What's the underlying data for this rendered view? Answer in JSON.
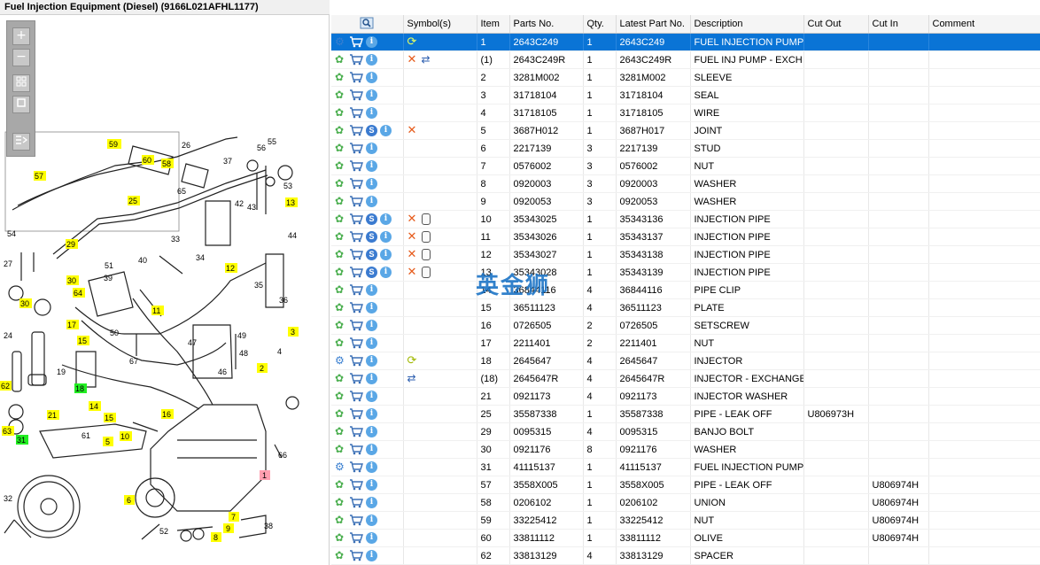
{
  "window": {
    "title": "Fuel Injection Equipment (Diesel) (9166L021AFHL1177)"
  },
  "watermark": "英金狮",
  "zoom_toolbar": {
    "zoom_in": "+",
    "zoom_out": "−"
  },
  "diagram": {
    "callouts": [
      {
        "n": "59",
        "hl": "yellow"
      },
      {
        "n": "60",
        "hl": "yellow"
      },
      {
        "n": "58",
        "hl": "yellow"
      },
      {
        "n": "26",
        "hl": "none"
      },
      {
        "n": "56",
        "hl": "none"
      },
      {
        "n": "55",
        "hl": "none"
      },
      {
        "n": "37",
        "hl": "none"
      },
      {
        "n": "57",
        "hl": "yellow"
      },
      {
        "n": "65",
        "hl": "none"
      },
      {
        "n": "53",
        "hl": "none"
      },
      {
        "n": "25",
        "hl": "yellow"
      },
      {
        "n": "42",
        "hl": "none"
      },
      {
        "n": "43",
        "hl": "none"
      },
      {
        "n": "13",
        "hl": "yellow"
      },
      {
        "n": "54",
        "hl": "none"
      },
      {
        "n": "29",
        "hl": "yellow"
      },
      {
        "n": "33",
        "hl": "none"
      },
      {
        "n": "44",
        "hl": "none"
      },
      {
        "n": "27",
        "hl": "none"
      },
      {
        "n": "51",
        "hl": "none"
      },
      {
        "n": "40",
        "hl": "none"
      },
      {
        "n": "34",
        "hl": "none"
      },
      {
        "n": "12",
        "hl": "yellow"
      },
      {
        "n": "30",
        "hl": "yellow"
      },
      {
        "n": "39",
        "hl": "none"
      },
      {
        "n": "64",
        "hl": "yellow"
      },
      {
        "n": "30",
        "hl": "yellow"
      },
      {
        "n": "11",
        "hl": "yellow"
      },
      {
        "n": "35",
        "hl": "none"
      },
      {
        "n": "36",
        "hl": "none"
      },
      {
        "n": "24",
        "hl": "none"
      },
      {
        "n": "17",
        "hl": "yellow"
      },
      {
        "n": "15",
        "hl": "yellow"
      },
      {
        "n": "50",
        "hl": "none"
      },
      {
        "n": "47",
        "hl": "none"
      },
      {
        "n": "49",
        "hl": "none"
      },
      {
        "n": "48",
        "hl": "none"
      },
      {
        "n": "3",
        "hl": "yellow"
      },
      {
        "n": "67",
        "hl": "none"
      },
      {
        "n": "46",
        "hl": "none"
      },
      {
        "n": "4",
        "hl": "none"
      },
      {
        "n": "62",
        "hl": "yellow"
      },
      {
        "n": "19",
        "hl": "none"
      },
      {
        "n": "18",
        "hl": "green"
      },
      {
        "n": "2",
        "hl": "yellow"
      },
      {
        "n": "14",
        "hl": "yellow"
      },
      {
        "n": "21",
        "hl": "yellow"
      },
      {
        "n": "15",
        "hl": "yellow"
      },
      {
        "n": "16",
        "hl": "yellow"
      },
      {
        "n": "63",
        "hl": "yellow"
      },
      {
        "n": "61",
        "hl": "none"
      },
      {
        "n": "10",
        "hl": "yellow"
      },
      {
        "n": "31",
        "hl": "green"
      },
      {
        "n": "5",
        "hl": "yellow"
      },
      {
        "n": "66",
        "hl": "none"
      },
      {
        "n": "1",
        "hl": "pink"
      },
      {
        "n": "6",
        "hl": "yellow"
      },
      {
        "n": "32",
        "hl": "none"
      },
      {
        "n": "52",
        "hl": "none"
      },
      {
        "n": "7",
        "hl": "yellow"
      },
      {
        "n": "9",
        "hl": "yellow"
      },
      {
        "n": "8",
        "hl": "yellow"
      },
      {
        "n": "38",
        "hl": "none"
      }
    ]
  },
  "grid": {
    "headers": {
      "icons": "",
      "symbols": "Symbol(s)",
      "item": "Item",
      "parts_no": "Parts No.",
      "qty": "Qty.",
      "latest": "Latest Part No.",
      "description": "Description",
      "cut_out": "Cut Out",
      "cut_in": "Cut In",
      "comment": "Comment"
    },
    "rows": [
      {
        "item": "1",
        "part": "2643C249",
        "qty": "1",
        "latest": "2643C249",
        "desc": "FUEL INJECTION PUMP",
        "cut_out": "",
        "cut_in": "",
        "comment": "",
        "s": false,
        "syms": [
          "recycle"
        ],
        "gear": "multi",
        "selected": true
      },
      {
        "item": "(1)",
        "part": "2643C249R",
        "qty": "1",
        "latest": "2643C249R",
        "desc": "FUEL INJ PUMP - EXCH",
        "cut_out": "",
        "cut_in": "",
        "comment": "",
        "s": false,
        "syms": [
          "x",
          "exchange"
        ],
        "gear": "single",
        "selected": false
      },
      {
        "item": "2",
        "part": "3281M002",
        "qty": "1",
        "latest": "3281M002",
        "desc": "SLEEVE",
        "cut_out": "",
        "cut_in": "",
        "comment": "",
        "s": false,
        "syms": [],
        "gear": "single",
        "selected": false
      },
      {
        "item": "3",
        "part": "31718104",
        "qty": "1",
        "latest": "31718104",
        "desc": "SEAL",
        "cut_out": "",
        "cut_in": "",
        "comment": "",
        "s": false,
        "syms": [],
        "gear": "single",
        "selected": false
      },
      {
        "item": "4",
        "part": "31718105",
        "qty": "1",
        "latest": "31718105",
        "desc": "WIRE",
        "cut_out": "",
        "cut_in": "",
        "comment": "",
        "s": false,
        "syms": [],
        "gear": "single",
        "selected": false
      },
      {
        "item": "5",
        "part": "3687H012",
        "qty": "1",
        "latest": "3687H017",
        "desc": "JOINT",
        "cut_out": "",
        "cut_in": "",
        "comment": "",
        "s": true,
        "syms": [
          "x"
        ],
        "gear": "single",
        "selected": false
      },
      {
        "item": "6",
        "part": "2217139",
        "qty": "3",
        "latest": "2217139",
        "desc": "STUD",
        "cut_out": "",
        "cut_in": "",
        "comment": "",
        "s": false,
        "syms": [],
        "gear": "single",
        "selected": false
      },
      {
        "item": "7",
        "part": "0576002",
        "qty": "3",
        "latest": "0576002",
        "desc": "NUT",
        "cut_out": "",
        "cut_in": "",
        "comment": "",
        "s": false,
        "syms": [],
        "gear": "single",
        "selected": false
      },
      {
        "item": "8",
        "part": "0920003",
        "qty": "3",
        "latest": "0920003",
        "desc": "WASHER",
        "cut_out": "",
        "cut_in": "",
        "comment": "",
        "s": false,
        "syms": [],
        "gear": "single",
        "selected": false
      },
      {
        "item": "9",
        "part": "0920053",
        "qty": "3",
        "latest": "0920053",
        "desc": "WASHER",
        "cut_out": "",
        "cut_in": "",
        "comment": "",
        "s": false,
        "syms": [],
        "gear": "single",
        "selected": false
      },
      {
        "item": "10",
        "part": "35343025",
        "qty": "1",
        "latest": "35343136",
        "desc": "INJECTION PIPE",
        "cut_out": "",
        "cut_in": "",
        "comment": "",
        "s": true,
        "syms": [
          "x",
          "can"
        ],
        "gear": "single",
        "selected": false
      },
      {
        "item": "11",
        "part": "35343026",
        "qty": "1",
        "latest": "35343137",
        "desc": "INJECTION PIPE",
        "cut_out": "",
        "cut_in": "",
        "comment": "",
        "s": true,
        "syms": [
          "x",
          "can"
        ],
        "gear": "single",
        "selected": false
      },
      {
        "item": "12",
        "part": "35343027",
        "qty": "1",
        "latest": "35343138",
        "desc": "INJECTION PIPE",
        "cut_out": "",
        "cut_in": "",
        "comment": "",
        "s": true,
        "syms": [
          "x",
          "can"
        ],
        "gear": "single",
        "selected": false
      },
      {
        "item": "13",
        "part": "35343028",
        "qty": "1",
        "latest": "35343139",
        "desc": "INJECTION PIPE",
        "cut_out": "",
        "cut_in": "",
        "comment": "",
        "s": true,
        "syms": [
          "x",
          "can"
        ],
        "gear": "single",
        "selected": false
      },
      {
        "item": "14",
        "part": "36844116",
        "qty": "4",
        "latest": "36844116",
        "desc": "PIPE CLIP",
        "cut_out": "",
        "cut_in": "",
        "comment": "",
        "s": false,
        "syms": [],
        "gear": "single",
        "selected": false
      },
      {
        "item": "15",
        "part": "36511123",
        "qty": "4",
        "latest": "36511123",
        "desc": "PLATE",
        "cut_out": "",
        "cut_in": "",
        "comment": "",
        "s": false,
        "syms": [],
        "gear": "single",
        "selected": false
      },
      {
        "item": "16",
        "part": "0726505",
        "qty": "2",
        "latest": "0726505",
        "desc": "SETSCREW",
        "cut_out": "",
        "cut_in": "",
        "comment": "",
        "s": false,
        "syms": [],
        "gear": "single",
        "selected": false
      },
      {
        "item": "17",
        "part": "2211401",
        "qty": "2",
        "latest": "2211401",
        "desc": "NUT",
        "cut_out": "",
        "cut_in": "",
        "comment": "",
        "s": false,
        "syms": [],
        "gear": "single",
        "selected": false
      },
      {
        "item": "18",
        "part": "2645647",
        "qty": "4",
        "latest": "2645647",
        "desc": "INJECTOR",
        "cut_out": "",
        "cut_in": "",
        "comment": "",
        "s": false,
        "syms": [
          "recycle"
        ],
        "gear": "multi",
        "selected": false
      },
      {
        "item": "(18)",
        "part": "2645647R",
        "qty": "4",
        "latest": "2645647R",
        "desc": "INJECTOR - EXCHANGE",
        "cut_out": "",
        "cut_in": "",
        "comment": "",
        "s": false,
        "syms": [
          "exchange"
        ],
        "gear": "single",
        "selected": false
      },
      {
        "item": "21",
        "part": "0921173",
        "qty": "4",
        "latest": "0921173",
        "desc": "INJECTOR WASHER",
        "cut_out": "",
        "cut_in": "",
        "comment": "",
        "s": false,
        "syms": [],
        "gear": "single",
        "selected": false
      },
      {
        "item": "25",
        "part": "35587338",
        "qty": "1",
        "latest": "35587338",
        "desc": "PIPE - LEAK OFF",
        "cut_out": "U806973H",
        "cut_in": "",
        "comment": "",
        "s": false,
        "syms": [],
        "gear": "single",
        "selected": false
      },
      {
        "item": "29",
        "part": "0095315",
        "qty": "4",
        "latest": "0095315",
        "desc": "BANJO BOLT",
        "cut_out": "",
        "cut_in": "",
        "comment": "",
        "s": false,
        "syms": [],
        "gear": "single",
        "selected": false
      },
      {
        "item": "30",
        "part": "0921176",
        "qty": "8",
        "latest": "0921176",
        "desc": "WASHER",
        "cut_out": "",
        "cut_in": "",
        "comment": "",
        "s": false,
        "syms": [],
        "gear": "single",
        "selected": false
      },
      {
        "item": "31",
        "part": "41115137",
        "qty": "1",
        "latest": "41115137",
        "desc": "FUEL INJECTION PUMP G",
        "cut_out": "",
        "cut_in": "",
        "comment": "",
        "s": false,
        "syms": [],
        "gear": "multi",
        "selected": false
      },
      {
        "item": "57",
        "part": "3558X005",
        "qty": "1",
        "latest": "3558X005",
        "desc": "PIPE - LEAK OFF",
        "cut_out": "",
        "cut_in": "U806974H",
        "comment": "",
        "s": false,
        "syms": [],
        "gear": "single",
        "selected": false
      },
      {
        "item": "58",
        "part": "0206102",
        "qty": "1",
        "latest": "0206102",
        "desc": "UNION",
        "cut_out": "",
        "cut_in": "U806974H",
        "comment": "",
        "s": false,
        "syms": [],
        "gear": "single",
        "selected": false
      },
      {
        "item": "59",
        "part": "33225412",
        "qty": "1",
        "latest": "33225412",
        "desc": "NUT",
        "cut_out": "",
        "cut_in": "U806974H",
        "comment": "",
        "s": false,
        "syms": [],
        "gear": "single",
        "selected": false
      },
      {
        "item": "60",
        "part": "33811112",
        "qty": "1",
        "latest": "33811112",
        "desc": "OLIVE",
        "cut_out": "",
        "cut_in": "U806974H",
        "comment": "",
        "s": false,
        "syms": [],
        "gear": "single",
        "selected": false
      },
      {
        "item": "62",
        "part": "33813129",
        "qty": "4",
        "latest": "33813129",
        "desc": "SPACER",
        "cut_out": "",
        "cut_in": "",
        "comment": "",
        "s": false,
        "syms": [],
        "gear": "single",
        "selected": false
      }
    ]
  }
}
